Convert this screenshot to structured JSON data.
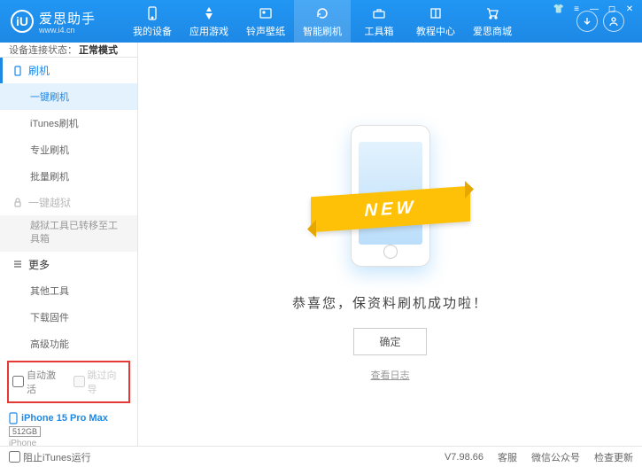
{
  "brand": {
    "name": "爱思助手",
    "url": "www.i4.cn",
    "logo_letter": "iU"
  },
  "nav": {
    "items": [
      {
        "label": "我的设备"
      },
      {
        "label": "应用游戏"
      },
      {
        "label": "铃声壁纸"
      },
      {
        "label": "智能刷机"
      },
      {
        "label": "工具箱"
      },
      {
        "label": "教程中心"
      },
      {
        "label": "爱思商城"
      }
    ],
    "active_index": 3
  },
  "status": {
    "label": "设备连接状态：",
    "value": "正常模式"
  },
  "sidebar": {
    "flash_head": "刷机",
    "flash_items": [
      "一键刷机",
      "iTunes刷机",
      "专业刷机",
      "批量刷机"
    ],
    "jailbreak_head": "一键越狱",
    "jailbreak_note": "越狱工具已转移至工具箱",
    "more_head": "更多",
    "more_items": [
      "其他工具",
      "下载固件",
      "高级功能"
    ]
  },
  "options": {
    "auto_activate": "自动激活",
    "skip_guide": "跳过向导"
  },
  "device": {
    "name": "iPhone 15 Pro Max",
    "storage": "512GB",
    "type": "iPhone"
  },
  "main": {
    "ribbon_text": "NEW",
    "success": "恭喜您，保资料刷机成功啦！",
    "ok": "确定",
    "log_link": "查看日志"
  },
  "footer": {
    "block_itunes": "阻止iTunes运行",
    "version": "V7.98.66",
    "links": [
      "客服",
      "微信公众号",
      "检查更新"
    ]
  }
}
